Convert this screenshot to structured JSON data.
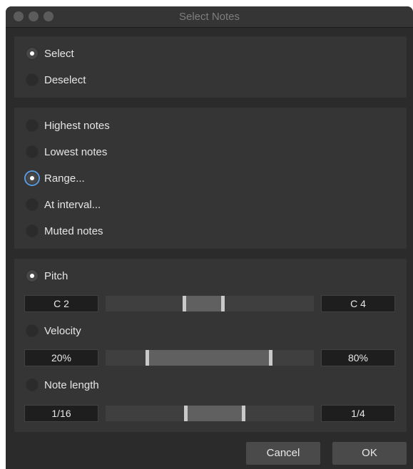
{
  "window": {
    "title": "Select Notes"
  },
  "mode": {
    "options": [
      {
        "label": "Select",
        "checked": true
      },
      {
        "label": "Deselect",
        "checked": false
      }
    ]
  },
  "which": {
    "options": [
      {
        "label": "Highest notes",
        "checked": false
      },
      {
        "label": "Lowest notes",
        "checked": false
      },
      {
        "label": "Range...",
        "checked": true
      },
      {
        "label": "At interval...",
        "checked": false
      },
      {
        "label": "Muted notes",
        "checked": false
      }
    ]
  },
  "criteria": {
    "pitch": {
      "label": "Pitch",
      "checked": true,
      "min": "C 2",
      "max": "C 4"
    },
    "velocity": {
      "label": "Velocity",
      "checked": false,
      "min": "20%",
      "max": "80%"
    },
    "length": {
      "label": "Note length",
      "checked": false,
      "min": "1/16",
      "max": "1/4"
    }
  },
  "buttons": {
    "cancel": "Cancel",
    "ok": "OK"
  }
}
